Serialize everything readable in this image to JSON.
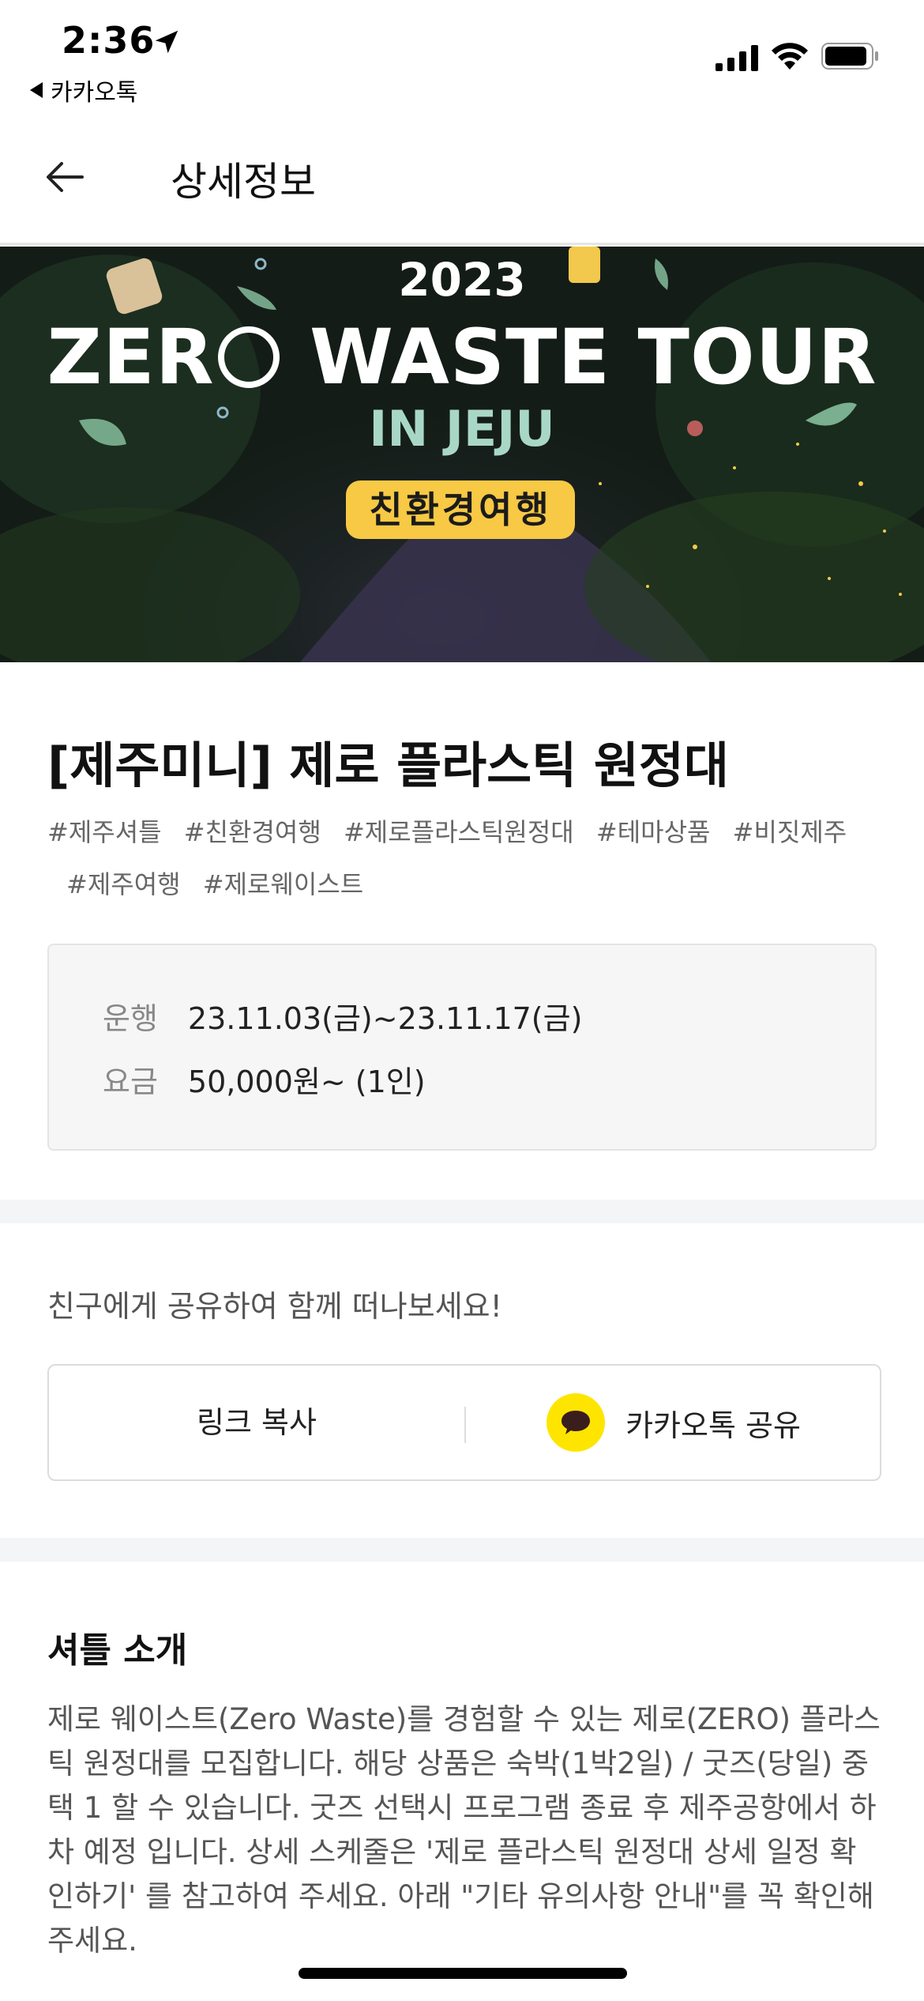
{
  "status_bar": {
    "time": "2:36",
    "back_app_label": "카카오톡",
    "icons": [
      "location-arrow-icon",
      "cellular-signal-icon",
      "wifi-icon",
      "battery-icon"
    ]
  },
  "header": {
    "title": "상세정보",
    "back_icon": "arrow-left-icon"
  },
  "banner": {
    "year": "2023",
    "headline_part1": "ZER",
    "headline_part2": " WASTE TOUR",
    "subtitle": "IN JEJU",
    "pill_label": "친환경여행",
    "pill_color": "#f7c944"
  },
  "product": {
    "title": "[제주미니] 제로 플라스틱 원정대",
    "tags": [
      "#제주셔틀",
      "#친환경여행",
      "#제로플라스틱원정대",
      "#테마상품",
      "#비짓제주",
      "#제주여행",
      "#제로웨이스트"
    ]
  },
  "info": {
    "operation_label": "운행",
    "operation_value": "23.11.03(금)~23.11.17(금)",
    "price_label": "요금",
    "price_value": "50,000원~ (1인)"
  },
  "share": {
    "hint": "친구에게 공유하여 함께 떠나보세요!",
    "copy_link_label": "링크 복사",
    "kakao_label": "카카오톡 공유",
    "kakao_color": "#fee500"
  },
  "shuttle_intro": {
    "title": "셔틀 소개",
    "description": "제로 웨이스트(Zero Waste)를 경험할 수 있는 제로(ZERO) 플라스틱 원정대를 모집합니다. 해당 상품은 숙박(1박2일) / 굿즈(당일) 중 택 1 할 수 있습니다. 굿즈 선택시 프로그램 종료 후 제주공항에서 하차 예정 입니다. 상세 스케줄은 '제로 플라스틱 원정대 상세 일정 확인하기' 를 참고하여 주세요. 아래 \"기타 유의사항 안내\"를 꼭 확인해 주세요."
  }
}
